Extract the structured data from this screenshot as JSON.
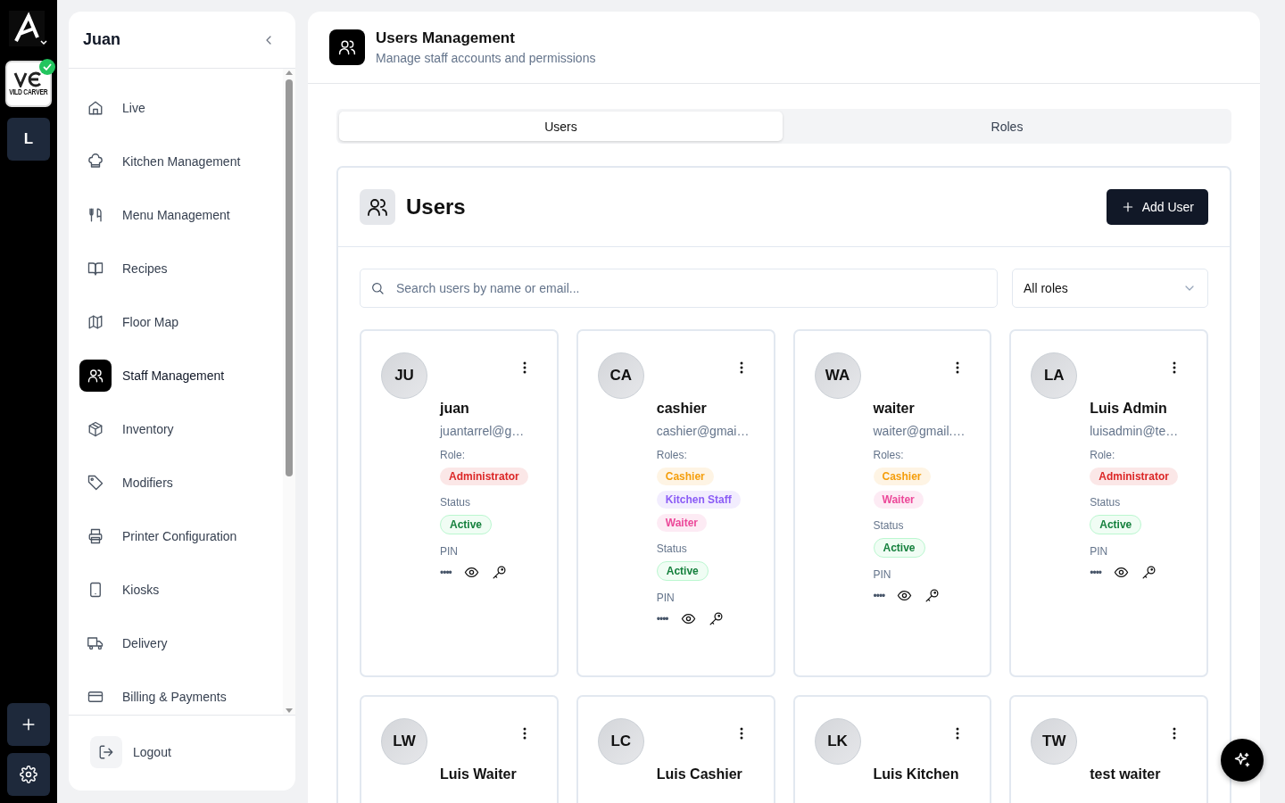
{
  "rail": {
    "org_initial": "L",
    "logo_text": "VILD CARVER",
    "logo_verified": true
  },
  "sidebar": {
    "title": "Juan",
    "items": [
      {
        "label": "Live",
        "selected": false
      },
      {
        "label": "Kitchen Management",
        "selected": false
      },
      {
        "label": "Menu Management",
        "selected": false
      },
      {
        "label": "Recipes",
        "selected": false
      },
      {
        "label": "Floor Map",
        "selected": false
      },
      {
        "label": "Staff Management",
        "selected": true
      },
      {
        "label": "Inventory",
        "selected": false
      },
      {
        "label": "Modifiers",
        "selected": false
      },
      {
        "label": "Printer Configuration",
        "selected": false
      },
      {
        "label": "Kiosks",
        "selected": false
      },
      {
        "label": "Delivery",
        "selected": false
      },
      {
        "label": "Billing & Payments",
        "selected": false
      }
    ],
    "logout": "Logout"
  },
  "header": {
    "title": "Users Management",
    "subtitle": "Manage staff accounts and permissions"
  },
  "tabs": [
    {
      "label": "Users",
      "selected": true
    },
    {
      "label": "Roles",
      "selected": false
    }
  ],
  "users_panel": {
    "title": "Users",
    "add_button": "Add User",
    "search": {
      "placeholder": "Search users by name or email..."
    },
    "role_filter": "All roles"
  },
  "users": [
    {
      "initials": "JU",
      "name": "juan",
      "email": "juantarrel@g…",
      "roles_label": "Role:",
      "roles": [
        {
          "label": "Administrator",
          "color": "#dc2626"
        }
      ],
      "status_label": "Status",
      "status": "Active",
      "pin_label": "PIN",
      "pin": "••••"
    },
    {
      "initials": "CA",
      "name": "cashier",
      "email": "cashier@gmai…",
      "roles_label": "Roles:",
      "roles": [
        {
          "label": "Cashier",
          "color": "#f59e0b"
        },
        {
          "label": "Kitchen Staff",
          "color": "#8b5cf6"
        },
        {
          "label": "Waiter",
          "color": "#ec4899"
        }
      ],
      "status_label": "Status",
      "status": "Active",
      "pin_label": "PIN",
      "pin": "••••"
    },
    {
      "initials": "WA",
      "name": "waiter",
      "email": "waiter@gmail.…",
      "roles_label": "Roles:",
      "roles": [
        {
          "label": "Cashier",
          "color": "#f59e0b"
        },
        {
          "label": "Waiter",
          "color": "#ec4899"
        }
      ],
      "status_label": "Status",
      "status": "Active",
      "pin_label": "PIN",
      "pin": "••••"
    },
    {
      "initials": "LA",
      "name": "Luis Admin",
      "email": "luisadmin@te…",
      "roles_label": "Role:",
      "roles": [
        {
          "label": "Administrator",
          "color": "#dc2626"
        }
      ],
      "status_label": "Status",
      "status": "Active",
      "pin_label": "PIN",
      "pin": "••••"
    },
    {
      "initials": "LW",
      "name": "Luis Waiter"
    },
    {
      "initials": "LC",
      "name": "Luis Cashier"
    },
    {
      "initials": "LK",
      "name": "Luis Kitchen"
    },
    {
      "initials": "TW",
      "name": "test waiter"
    }
  ]
}
